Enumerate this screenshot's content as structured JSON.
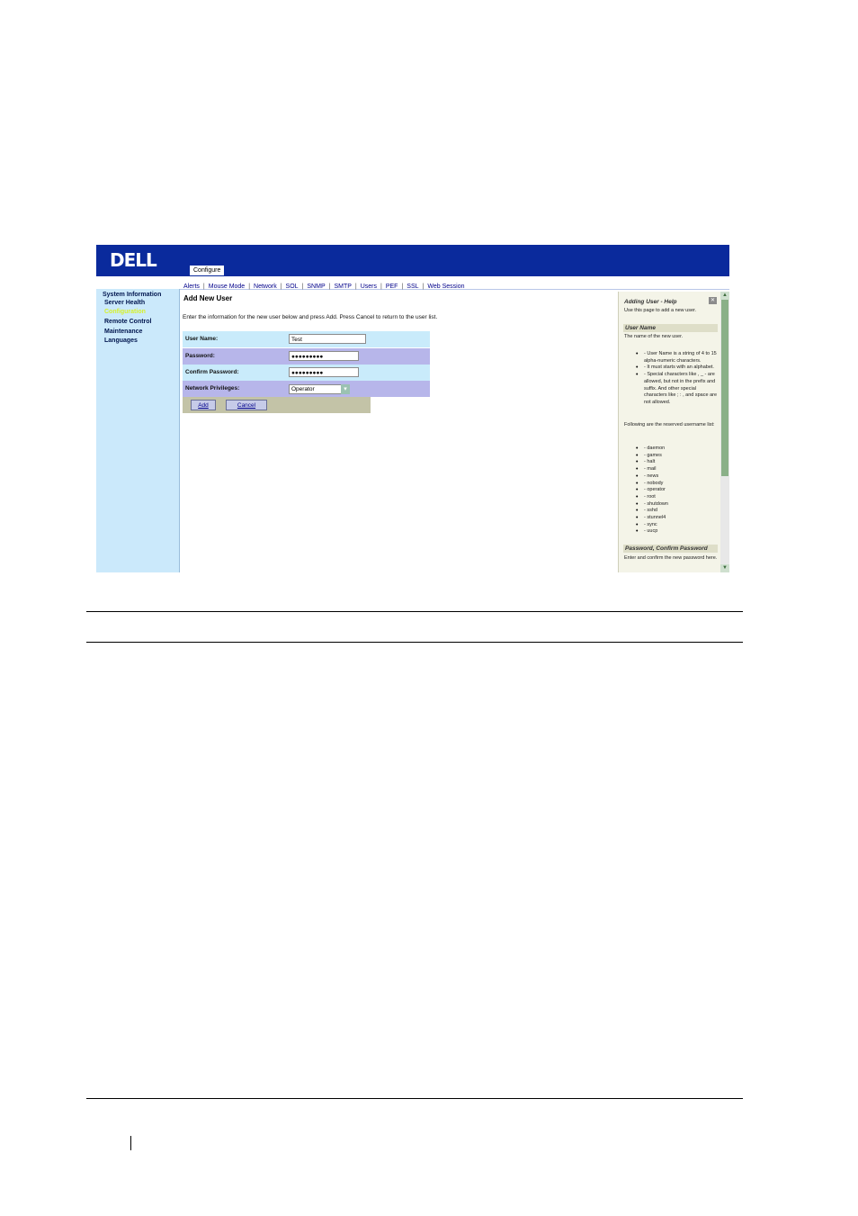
{
  "header": {
    "logo": "DELL",
    "active_tab": "Configure"
  },
  "tabs": [
    "Alerts",
    "Mouse Mode",
    "Network",
    "SOL",
    "SNMP",
    "SMTP",
    "Users",
    "PEF",
    "SSL",
    "Web Session"
  ],
  "sidebar": {
    "items": [
      {
        "label": "System Information"
      },
      {
        "label": "Server Health"
      },
      {
        "label": "Configuration"
      },
      {
        "label": "Remote Control"
      },
      {
        "label": "Maintenance"
      },
      {
        "label": "Languages"
      }
    ]
  },
  "main": {
    "title": "Add New User",
    "description": "Enter the information for the new user below and press Add. Press Cancel to return to the user list.",
    "fields": {
      "username_label": "User Name:",
      "username_value": "Test",
      "password_label": "Password:",
      "password_value": "●●●●●●●●●",
      "confirm_label": "Confirm Password:",
      "confirm_value": "●●●●●●●●●",
      "privileges_label": "Network Privileges:",
      "privileges_value": "Operator"
    },
    "buttons": {
      "add": "Add",
      "cancel": "Cancel"
    }
  },
  "help": {
    "title": "Adding User - Help",
    "intro": "Use this page to add a new user.",
    "user_name_heading": "User Name",
    "user_name_text": "The name of the new user.",
    "rules": [
      "- User Name is a string of 4 to 15 alpha-numeric characters.",
      "- It must starts with an alphabet.",
      "- Special characters like , _ - are allowed, but not in the prefix and suffix. And other special characters like ; : , and space are not allowed."
    ],
    "reserved_intro": "Following are the reserved username list:",
    "reserved": [
      "- daemon",
      "- games",
      "- halt",
      "- mail",
      "- news",
      "- nobody",
      "- operator",
      "- root",
      "- shutdown",
      "- sshd",
      "- stunnel4",
      "- sync",
      "- uucp"
    ],
    "password_heading": "Password, Confirm Password",
    "password_text": "Enter and confirm the new password here."
  }
}
